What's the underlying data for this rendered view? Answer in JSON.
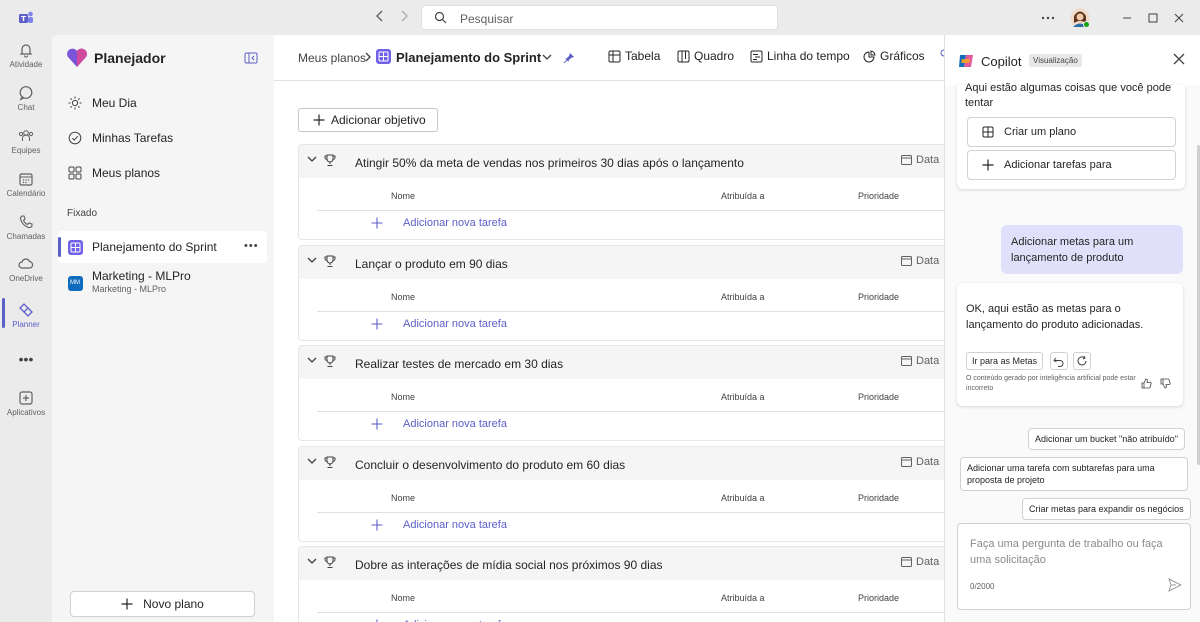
{
  "titlebar": {
    "search_placeholder": "Pesquisar"
  },
  "rail": {
    "items": [
      {
        "label": "Atividade",
        "icon": "bell-icon"
      },
      {
        "label": "Chat",
        "icon": "chat-icon"
      },
      {
        "label": "Equipes",
        "icon": "teams-icon"
      },
      {
        "label": "Calendário",
        "icon": "calendar-icon"
      },
      {
        "label": "Chamadas",
        "icon": "phone-icon"
      },
      {
        "label": "OneDrive",
        "icon": "cloud-icon"
      },
      {
        "label": "Planner",
        "icon": "planner-icon"
      },
      {
        "label": "Aplicativos",
        "icon": "add-app-icon"
      }
    ]
  },
  "sidebar": {
    "title": "Planejador",
    "nav": [
      {
        "label": "Meu Dia",
        "icon": "sun-icon"
      },
      {
        "label": "Minhas Tarefas",
        "icon": "check-circle-icon"
      },
      {
        "label": "Meus planos",
        "icon": "grid-icon"
      }
    ],
    "pinned_label": "Fixado",
    "pinned": [
      {
        "label": "Planejamento do Sprint"
      },
      {
        "label": "Marketing - MLPro",
        "sub": "Marketing - MLPro",
        "initials": "MM"
      }
    ],
    "new_plan": "Novo plano"
  },
  "main": {
    "breadcrumb": "Meus planos",
    "plan_title": "Planejamento do Sprint",
    "views": [
      "Tabela",
      "Quadro",
      "Linha do tempo",
      "Gráficos"
    ],
    "add_goal": "Adicionar objetivo",
    "col_name": "Nome",
    "col_assigned": "Atribuída a",
    "col_priority": "Prioridade",
    "col_date": "Data",
    "add_task": "Adicionar nova tarefa",
    "goals": [
      "Atingir 50% da meta de vendas nos primeiros 30 dias após o lançamento",
      "Lançar o produto em 90 dias",
      "Realizar testes de mercado em 30 dias",
      "Concluir o desenvolvimento do produto em 60 dias",
      "Dobre as interações de mídia social nos próximos 90 dias"
    ]
  },
  "copilot": {
    "title": "Copilot",
    "badge": "Visualização",
    "intro": "Aqui estão algumas coisas que você pode tentar",
    "suggestions": [
      "Criar um plano",
      "Adicionar tarefas para"
    ],
    "user_message": "Adicionar metas para um lançamento de produto",
    "reply": "OK, aqui estão as metas para o lançamento do produto adicionadas.",
    "goto_button": "Ir para as Metas",
    "disclaimer": "O conteúdo gerado por inteligência artificial pode estar incorreto",
    "chips": [
      "Adicionar um bucket \"não atribuído\"",
      "Adicionar uma tarefa com subtarefas para uma proposta de projeto",
      "Criar metas para expandir os negócios"
    ],
    "input_placeholder": "Faça uma pergunta de trabalho ou faça uma solicitação",
    "counter": "0/2000"
  }
}
